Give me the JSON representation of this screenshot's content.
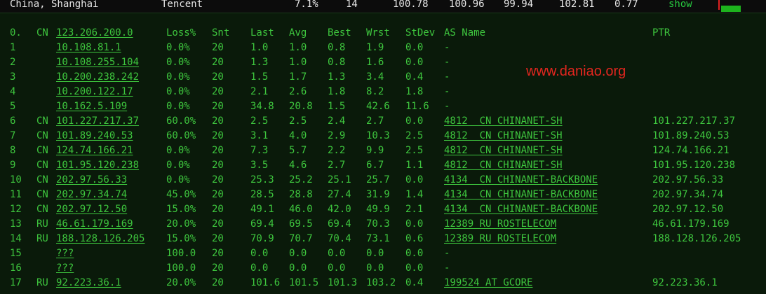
{
  "summary": {
    "location": "China, Shanghai",
    "provider": "Tencent",
    "loss": "7.1%",
    "snt": "14",
    "last": "100.78",
    "avg": "100.96",
    "best": "99.94",
    "wrst": "102.81",
    "stdev": "0.77",
    "show_label": "show"
  },
  "watermark": "www.daniao.org",
  "columns": {
    "hop": "0.",
    "cc": "CN",
    "host": "123.206.200.0",
    "loss": "Loss%",
    "snt": "Snt",
    "last": "Last",
    "avg": "Avg",
    "best": "Best",
    "wrst": "Wrst",
    "stdev": "StDev",
    "asname": "AS Name",
    "ptr": "PTR"
  },
  "hops": [
    {
      "hop": "1",
      "cc": "",
      "host": "10.108.81.1",
      "loss": "0.0%",
      "snt": "20",
      "last": "1.0",
      "avg": "1.0",
      "best": "0.8",
      "wrst": "1.9",
      "stdev": "0.0",
      "asname": "-",
      "ptr": ""
    },
    {
      "hop": "2",
      "cc": "",
      "host": "10.108.255.104",
      "loss": "0.0%",
      "snt": "20",
      "last": "1.3",
      "avg": "1.0",
      "best": "0.8",
      "wrst": "1.6",
      "stdev": "0.0",
      "asname": "-",
      "ptr": ""
    },
    {
      "hop": "3",
      "cc": "",
      "host": "10.200.238.242",
      "loss": "0.0%",
      "snt": "20",
      "last": "1.5",
      "avg": "1.7",
      "best": "1.3",
      "wrst": "3.4",
      "stdev": "0.4",
      "asname": "-",
      "ptr": ""
    },
    {
      "hop": "4",
      "cc": "",
      "host": "10.200.122.17",
      "loss": "0.0%",
      "snt": "20",
      "last": "2.1",
      "avg": "2.6",
      "best": "1.8",
      "wrst": "8.2",
      "stdev": "1.8",
      "asname": "-",
      "ptr": ""
    },
    {
      "hop": "5",
      "cc": "",
      "host": "10.162.5.109",
      "loss": "0.0%",
      "snt": "20",
      "last": "34.8",
      "avg": "20.8",
      "best": "1.5",
      "wrst": "42.6",
      "stdev": "11.6",
      "asname": "-",
      "ptr": ""
    },
    {
      "hop": "6",
      "cc": "CN",
      "host": "101.227.217.37",
      "loss": "60.0%",
      "snt": "20",
      "last": "2.5",
      "avg": "2.5",
      "best": "2.4",
      "wrst": "2.7",
      "stdev": "0.0",
      "asname": "4812  CN CHINANET-SH",
      "ptr": "101.227.217.37"
    },
    {
      "hop": "7",
      "cc": "CN",
      "host": "101.89.240.53",
      "loss": "60.0%",
      "snt": "20",
      "last": "3.1",
      "avg": "4.0",
      "best": "2.9",
      "wrst": "10.3",
      "stdev": "2.5",
      "asname": "4812  CN CHINANET-SH",
      "ptr": "101.89.240.53"
    },
    {
      "hop": "8",
      "cc": "CN",
      "host": "124.74.166.21",
      "loss": "0.0%",
      "snt": "20",
      "last": "7.3",
      "avg": "5.7",
      "best": "2.2",
      "wrst": "9.9",
      "stdev": "2.5",
      "asname": "4812  CN CHINANET-SH",
      "ptr": "124.74.166.21"
    },
    {
      "hop": "9",
      "cc": "CN",
      "host": "101.95.120.238",
      "loss": "0.0%",
      "snt": "20",
      "last": "3.5",
      "avg": "4.6",
      "best": "2.7",
      "wrst": "6.7",
      "stdev": "1.1",
      "asname": "4812  CN CHINANET-SH",
      "ptr": "101.95.120.238"
    },
    {
      "hop": "10",
      "cc": "CN",
      "host": "202.97.56.33",
      "loss": "0.0%",
      "snt": "20",
      "last": "25.3",
      "avg": "25.2",
      "best": "25.1",
      "wrst": "25.7",
      "stdev": "0.0",
      "asname": "4134  CN CHINANET-BACKBONE",
      "ptr": "202.97.56.33"
    },
    {
      "hop": "11",
      "cc": "CN",
      "host": "202.97.34.74",
      "loss": "45.0%",
      "snt": "20",
      "last": "28.5",
      "avg": "28.8",
      "best": "27.4",
      "wrst": "31.9",
      "stdev": "1.4",
      "asname": "4134  CN CHINANET-BACKBONE",
      "ptr": "202.97.34.74"
    },
    {
      "hop": "12",
      "cc": "CN",
      "host": "202.97.12.50",
      "loss": "15.0%",
      "snt": "20",
      "last": "49.1",
      "avg": "46.0",
      "best": "42.0",
      "wrst": "49.9",
      "stdev": "2.1",
      "asname": "4134  CN CHINANET-BACKBONE",
      "ptr": "202.97.12.50"
    },
    {
      "hop": "13",
      "cc": "RU",
      "host": "46.61.179.169",
      "loss": "20.0%",
      "snt": "20",
      "last": "69.4",
      "avg": "69.5",
      "best": "69.4",
      "wrst": "70.3",
      "stdev": "0.0",
      "asname": "12389 RU ROSTELECOM",
      "ptr": "46.61.179.169"
    },
    {
      "hop": "14",
      "cc": "RU",
      "host": "188.128.126.205",
      "loss": "15.0%",
      "snt": "20",
      "last": "70.9",
      "avg": "70.7",
      "best": "70.4",
      "wrst": "73.1",
      "stdev": "0.6",
      "asname": "12389 RU ROSTELECOM",
      "ptr": "188.128.126.205"
    },
    {
      "hop": "15",
      "cc": "",
      "host": "???",
      "loss": "100.0",
      "snt": "20",
      "last": "0.0",
      "avg": "0.0",
      "best": "0.0",
      "wrst": "0.0",
      "stdev": "0.0",
      "asname": "-",
      "ptr": ""
    },
    {
      "hop": "16",
      "cc": "",
      "host": "???",
      "loss": "100.0",
      "snt": "20",
      "last": "0.0",
      "avg": "0.0",
      "best": "0.0",
      "wrst": "0.0",
      "stdev": "0.0",
      "asname": "-",
      "ptr": ""
    },
    {
      "hop": "17",
      "cc": "RU",
      "host": "92.223.36.1",
      "loss": "20.0%",
      "snt": "20",
      "last": "101.6",
      "avg": "101.5",
      "best": "101.3",
      "wrst": "103.2",
      "stdev": "0.4",
      "asname": "199524 AT GCORE",
      "ptr": "92.223.36.1"
    }
  ]
}
